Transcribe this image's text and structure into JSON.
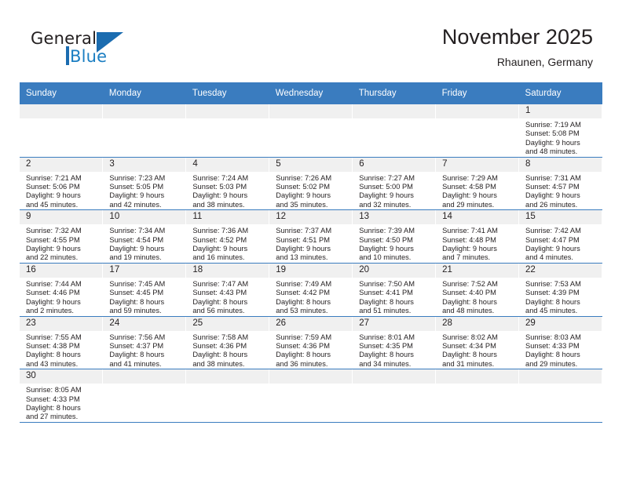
{
  "brand": {
    "word_one": "General",
    "word_two": "Blue",
    "logo_icon": "triangle-logo-icon",
    "color_dark": "#231f20",
    "color_blue": "#1b7ec2"
  },
  "header": {
    "title": "November 2025",
    "subtitle": "Rhaunen, Germany"
  },
  "calendar": {
    "header_bg": "#3a7cbf",
    "daynum_bg": "#f0f0f0",
    "weekdays": [
      "Sunday",
      "Monday",
      "Tuesday",
      "Wednesday",
      "Thursday",
      "Friday",
      "Saturday"
    ],
    "weeks": [
      [
        {
          "day": "",
          "lines": []
        },
        {
          "day": "",
          "lines": []
        },
        {
          "day": "",
          "lines": []
        },
        {
          "day": "",
          "lines": []
        },
        {
          "day": "",
          "lines": []
        },
        {
          "day": "",
          "lines": []
        },
        {
          "day": "1",
          "lines": [
            "Sunrise: 7:19 AM",
            "Sunset: 5:08 PM",
            "Daylight: 9 hours",
            "and 48 minutes."
          ]
        }
      ],
      [
        {
          "day": "2",
          "lines": [
            "Sunrise: 7:21 AM",
            "Sunset: 5:06 PM",
            "Daylight: 9 hours",
            "and 45 minutes."
          ]
        },
        {
          "day": "3",
          "lines": [
            "Sunrise: 7:23 AM",
            "Sunset: 5:05 PM",
            "Daylight: 9 hours",
            "and 42 minutes."
          ]
        },
        {
          "day": "4",
          "lines": [
            "Sunrise: 7:24 AM",
            "Sunset: 5:03 PM",
            "Daylight: 9 hours",
            "and 38 minutes."
          ]
        },
        {
          "day": "5",
          "lines": [
            "Sunrise: 7:26 AM",
            "Sunset: 5:02 PM",
            "Daylight: 9 hours",
            "and 35 minutes."
          ]
        },
        {
          "day": "6",
          "lines": [
            "Sunrise: 7:27 AM",
            "Sunset: 5:00 PM",
            "Daylight: 9 hours",
            "and 32 minutes."
          ]
        },
        {
          "day": "7",
          "lines": [
            "Sunrise: 7:29 AM",
            "Sunset: 4:58 PM",
            "Daylight: 9 hours",
            "and 29 minutes."
          ]
        },
        {
          "day": "8",
          "lines": [
            "Sunrise: 7:31 AM",
            "Sunset: 4:57 PM",
            "Daylight: 9 hours",
            "and 26 minutes."
          ]
        }
      ],
      [
        {
          "day": "9",
          "lines": [
            "Sunrise: 7:32 AM",
            "Sunset: 4:55 PM",
            "Daylight: 9 hours",
            "and 22 minutes."
          ]
        },
        {
          "day": "10",
          "lines": [
            "Sunrise: 7:34 AM",
            "Sunset: 4:54 PM",
            "Daylight: 9 hours",
            "and 19 minutes."
          ]
        },
        {
          "day": "11",
          "lines": [
            "Sunrise: 7:36 AM",
            "Sunset: 4:52 PM",
            "Daylight: 9 hours",
            "and 16 minutes."
          ]
        },
        {
          "day": "12",
          "lines": [
            "Sunrise: 7:37 AM",
            "Sunset: 4:51 PM",
            "Daylight: 9 hours",
            "and 13 minutes."
          ]
        },
        {
          "day": "13",
          "lines": [
            "Sunrise: 7:39 AM",
            "Sunset: 4:50 PM",
            "Daylight: 9 hours",
            "and 10 minutes."
          ]
        },
        {
          "day": "14",
          "lines": [
            "Sunrise: 7:41 AM",
            "Sunset: 4:48 PM",
            "Daylight: 9 hours",
            "and 7 minutes."
          ]
        },
        {
          "day": "15",
          "lines": [
            "Sunrise: 7:42 AM",
            "Sunset: 4:47 PM",
            "Daylight: 9 hours",
            "and 4 minutes."
          ]
        }
      ],
      [
        {
          "day": "16",
          "lines": [
            "Sunrise: 7:44 AM",
            "Sunset: 4:46 PM",
            "Daylight: 9 hours",
            "and 2 minutes."
          ]
        },
        {
          "day": "17",
          "lines": [
            "Sunrise: 7:45 AM",
            "Sunset: 4:45 PM",
            "Daylight: 8 hours",
            "and 59 minutes."
          ]
        },
        {
          "day": "18",
          "lines": [
            "Sunrise: 7:47 AM",
            "Sunset: 4:43 PM",
            "Daylight: 8 hours",
            "and 56 minutes."
          ]
        },
        {
          "day": "19",
          "lines": [
            "Sunrise: 7:49 AM",
            "Sunset: 4:42 PM",
            "Daylight: 8 hours",
            "and 53 minutes."
          ]
        },
        {
          "day": "20",
          "lines": [
            "Sunrise: 7:50 AM",
            "Sunset: 4:41 PM",
            "Daylight: 8 hours",
            "and 51 minutes."
          ]
        },
        {
          "day": "21",
          "lines": [
            "Sunrise: 7:52 AM",
            "Sunset: 4:40 PM",
            "Daylight: 8 hours",
            "and 48 minutes."
          ]
        },
        {
          "day": "22",
          "lines": [
            "Sunrise: 7:53 AM",
            "Sunset: 4:39 PM",
            "Daylight: 8 hours",
            "and 45 minutes."
          ]
        }
      ],
      [
        {
          "day": "23",
          "lines": [
            "Sunrise: 7:55 AM",
            "Sunset: 4:38 PM",
            "Daylight: 8 hours",
            "and 43 minutes."
          ]
        },
        {
          "day": "24",
          "lines": [
            "Sunrise: 7:56 AM",
            "Sunset: 4:37 PM",
            "Daylight: 8 hours",
            "and 41 minutes."
          ]
        },
        {
          "day": "25",
          "lines": [
            "Sunrise: 7:58 AM",
            "Sunset: 4:36 PM",
            "Daylight: 8 hours",
            "and 38 minutes."
          ]
        },
        {
          "day": "26",
          "lines": [
            "Sunrise: 7:59 AM",
            "Sunset: 4:36 PM",
            "Daylight: 8 hours",
            "and 36 minutes."
          ]
        },
        {
          "day": "27",
          "lines": [
            "Sunrise: 8:01 AM",
            "Sunset: 4:35 PM",
            "Daylight: 8 hours",
            "and 34 minutes."
          ]
        },
        {
          "day": "28",
          "lines": [
            "Sunrise: 8:02 AM",
            "Sunset: 4:34 PM",
            "Daylight: 8 hours",
            "and 31 minutes."
          ]
        },
        {
          "day": "29",
          "lines": [
            "Sunrise: 8:03 AM",
            "Sunset: 4:33 PM",
            "Daylight: 8 hours",
            "and 29 minutes."
          ]
        }
      ],
      [
        {
          "day": "30",
          "lines": [
            "Sunrise: 8:05 AM",
            "Sunset: 4:33 PM",
            "Daylight: 8 hours",
            "and 27 minutes."
          ]
        },
        {
          "day": "",
          "lines": []
        },
        {
          "day": "",
          "lines": []
        },
        {
          "day": "",
          "lines": []
        },
        {
          "day": "",
          "lines": []
        },
        {
          "day": "",
          "lines": []
        },
        {
          "day": "",
          "lines": []
        }
      ]
    ]
  }
}
